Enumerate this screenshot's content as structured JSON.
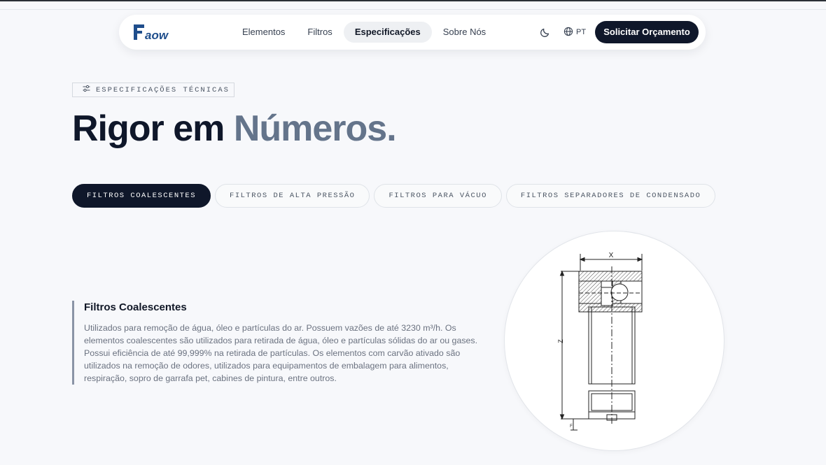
{
  "brand": {
    "logo_text": "Faow",
    "primary_color": "#1f4e8c"
  },
  "nav": {
    "links": [
      "Elementos",
      "Filtros",
      "Especificações",
      "Sobre Nós"
    ],
    "active": "Especificações",
    "language": "PT",
    "cta": "Solicitar Orçamento"
  },
  "hero": {
    "eyebrow": "ESPECIFICAÇÕES TÉCNICAS",
    "title_main": "Rigor em",
    "title_accent": "Números."
  },
  "tabs": [
    "FILTROS COALESCENTES",
    "FILTROS DE ALTA PRESSÃO",
    "FILTROS PARA VÁCUO",
    "FILTROS SEPARADORES DE CONDENSADO"
  ],
  "active_tab": "FILTROS COALESCENTES",
  "detail": {
    "heading": "Filtros Coalescentes",
    "body": "Utilizados para remoção de água, óleo e partículas do ar. Possuem vazões de até 3230 m³/h. Os elementos coalescentes são utilizados para retirada de água, óleo e partículas sólidas do ar ou gases. Possui eficiência de até 99,999% na retirada de partículas. Os elementos com carvão ativado são utilizados na remoção de odores, utilizados para equipamentos de embalagem para alimentos, respiração, sopro de garrafa pet, cabines de pintura, entre outros."
  },
  "drawing": {
    "dim_x": "X",
    "dim_z": "Z",
    "dim_f": "F"
  },
  "icons": {
    "moon": "moon-icon",
    "globe": "globe-icon",
    "sliders": "sliders-icon"
  },
  "colors": {
    "dark": "#0f172a",
    "accent_text": "#64748b",
    "background": "#f7f8fb"
  }
}
